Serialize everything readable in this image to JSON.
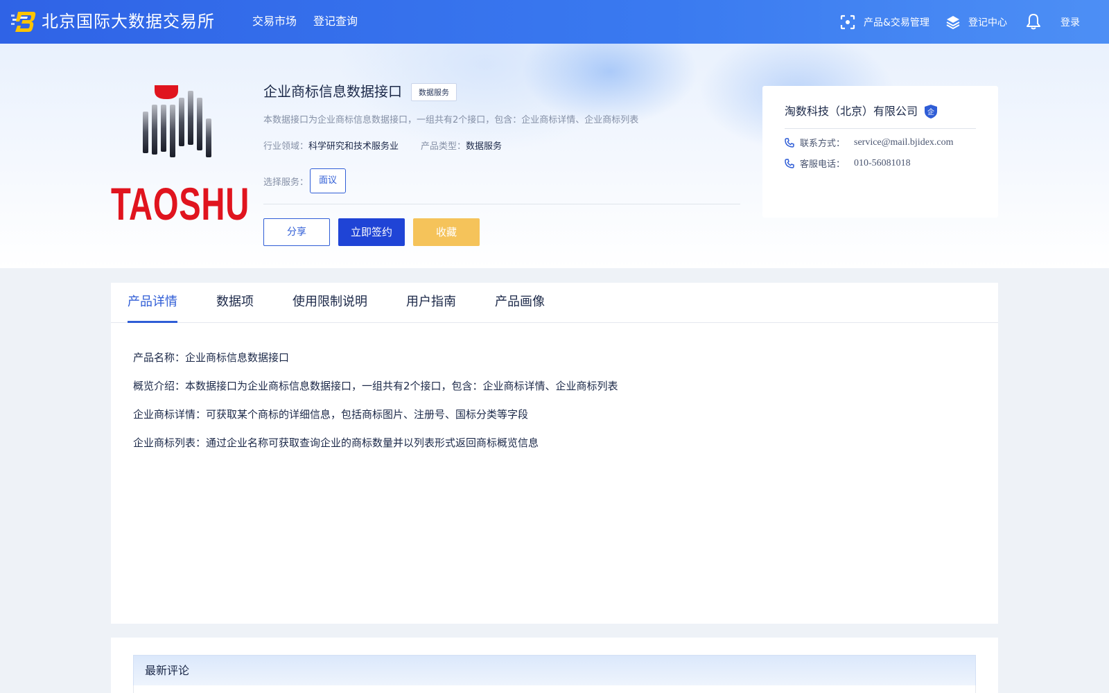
{
  "header": {
    "brand": "北京国际大数据交易所",
    "nav": [
      "交易市场",
      "登记查询"
    ],
    "manage_label": "产品&交易管理",
    "register_center_label": "登记中心",
    "login_label": "登录"
  },
  "product": {
    "logo_text": "TAOSHU",
    "title": "企业商标信息数据接口",
    "tag": "数据服务",
    "description": "本数据接口为企业商标信息数据接口，一组共有2个接口，包含：企业商标详情、企业商标列表",
    "industry_label": "行业领域：",
    "industry_value": "科学研究和技术服务业",
    "type_label": "产品类型：",
    "type_value": "数据服务",
    "service_label": "选择服务：",
    "service_option": "面议",
    "share_label": "分享",
    "sign_label": "立即签约",
    "favorite_label": "收藏"
  },
  "company": {
    "name": "淘数科技（北京）有限公司",
    "badge_text": "企",
    "contact_label": "联系方式：",
    "contact_value": "service@mail.bjidex.com",
    "phone_label": "客服电话：",
    "phone_value": "010-56081018"
  },
  "tabs": [
    "产品详情",
    "数据项",
    "使用限制说明",
    "用户指南",
    "产品画像"
  ],
  "active_tab": 0,
  "details": [
    "产品名称：企业商标信息数据接口",
    "概览介绍：本数据接口为企业商标信息数据接口，一组共有2个接口，包含：企业商标详情、企业商标列表",
    "企业商标详情：可获取某个商标的详细信息，包括商标图片、注册号、国标分类等字段",
    "企业商标列表：通过企业名称可获取查询企业的商标数量并以列表形式返回商标概览信息"
  ],
  "comments": {
    "title": "最新评论"
  },
  "colors": {
    "primary": "#1f44d6",
    "accent_blue": "#2f5dd6",
    "favorite": "#f5c35a",
    "logo_red": "#e0141e"
  },
  "icons": {
    "brand": "bjidex-logo-icon",
    "manage": "scan-frame-icon",
    "register_center": "layers-icon",
    "notifications": "bell-icon",
    "phone": "phone-icon",
    "verified": "shield-enterprise-icon"
  }
}
